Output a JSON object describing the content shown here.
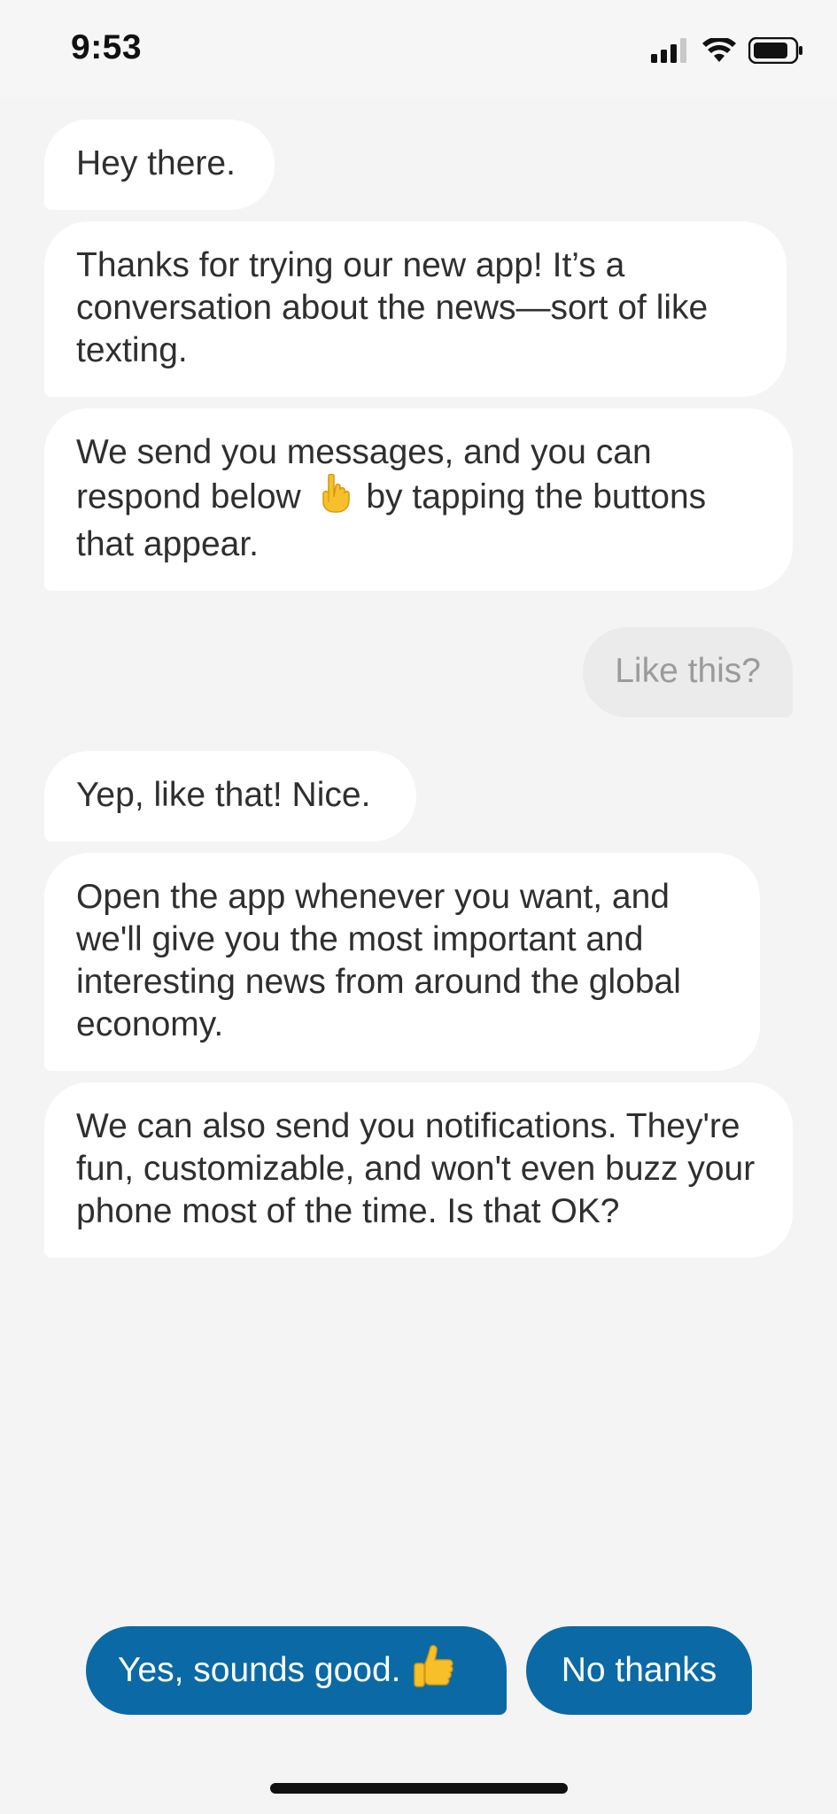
{
  "status_bar": {
    "time": "9:53",
    "icons": [
      "cellular-signal-icon",
      "wifi-icon",
      "battery-icon"
    ]
  },
  "messages": [
    {
      "from": "bot",
      "text": "Hey there."
    },
    {
      "from": "bot",
      "text": "Thanks for trying our new app! It’s a conversation about the news—sort of like texting."
    },
    {
      "from": "bot",
      "text_before": "We send you messages, and you can respond below",
      "emoji": "pointing-down-hand-icon",
      "text_after": "by tapping the buttons that appear."
    },
    {
      "from": "user",
      "text": "Like this?"
    },
    {
      "from": "bot",
      "text": "Yep, like that! Nice."
    },
    {
      "from": "bot",
      "text": "Open the app whenever you want, and we'll give you the most important and interesting news from around the global economy."
    },
    {
      "from": "bot",
      "text": "We can also send you notifications. They're fun, customizable, and won't even buzz your phone most of the time. Is that OK?"
    }
  ],
  "actions": {
    "yes_label": "Yes, sounds good.",
    "yes_emoji": "thumbs-up-icon",
    "no_label": "No thanks"
  },
  "colors": {
    "background": "#f4f4f4",
    "bubble_bot": "#ffffff",
    "bubble_user": "#ebebeb",
    "accent": "#0b6aa5"
  }
}
